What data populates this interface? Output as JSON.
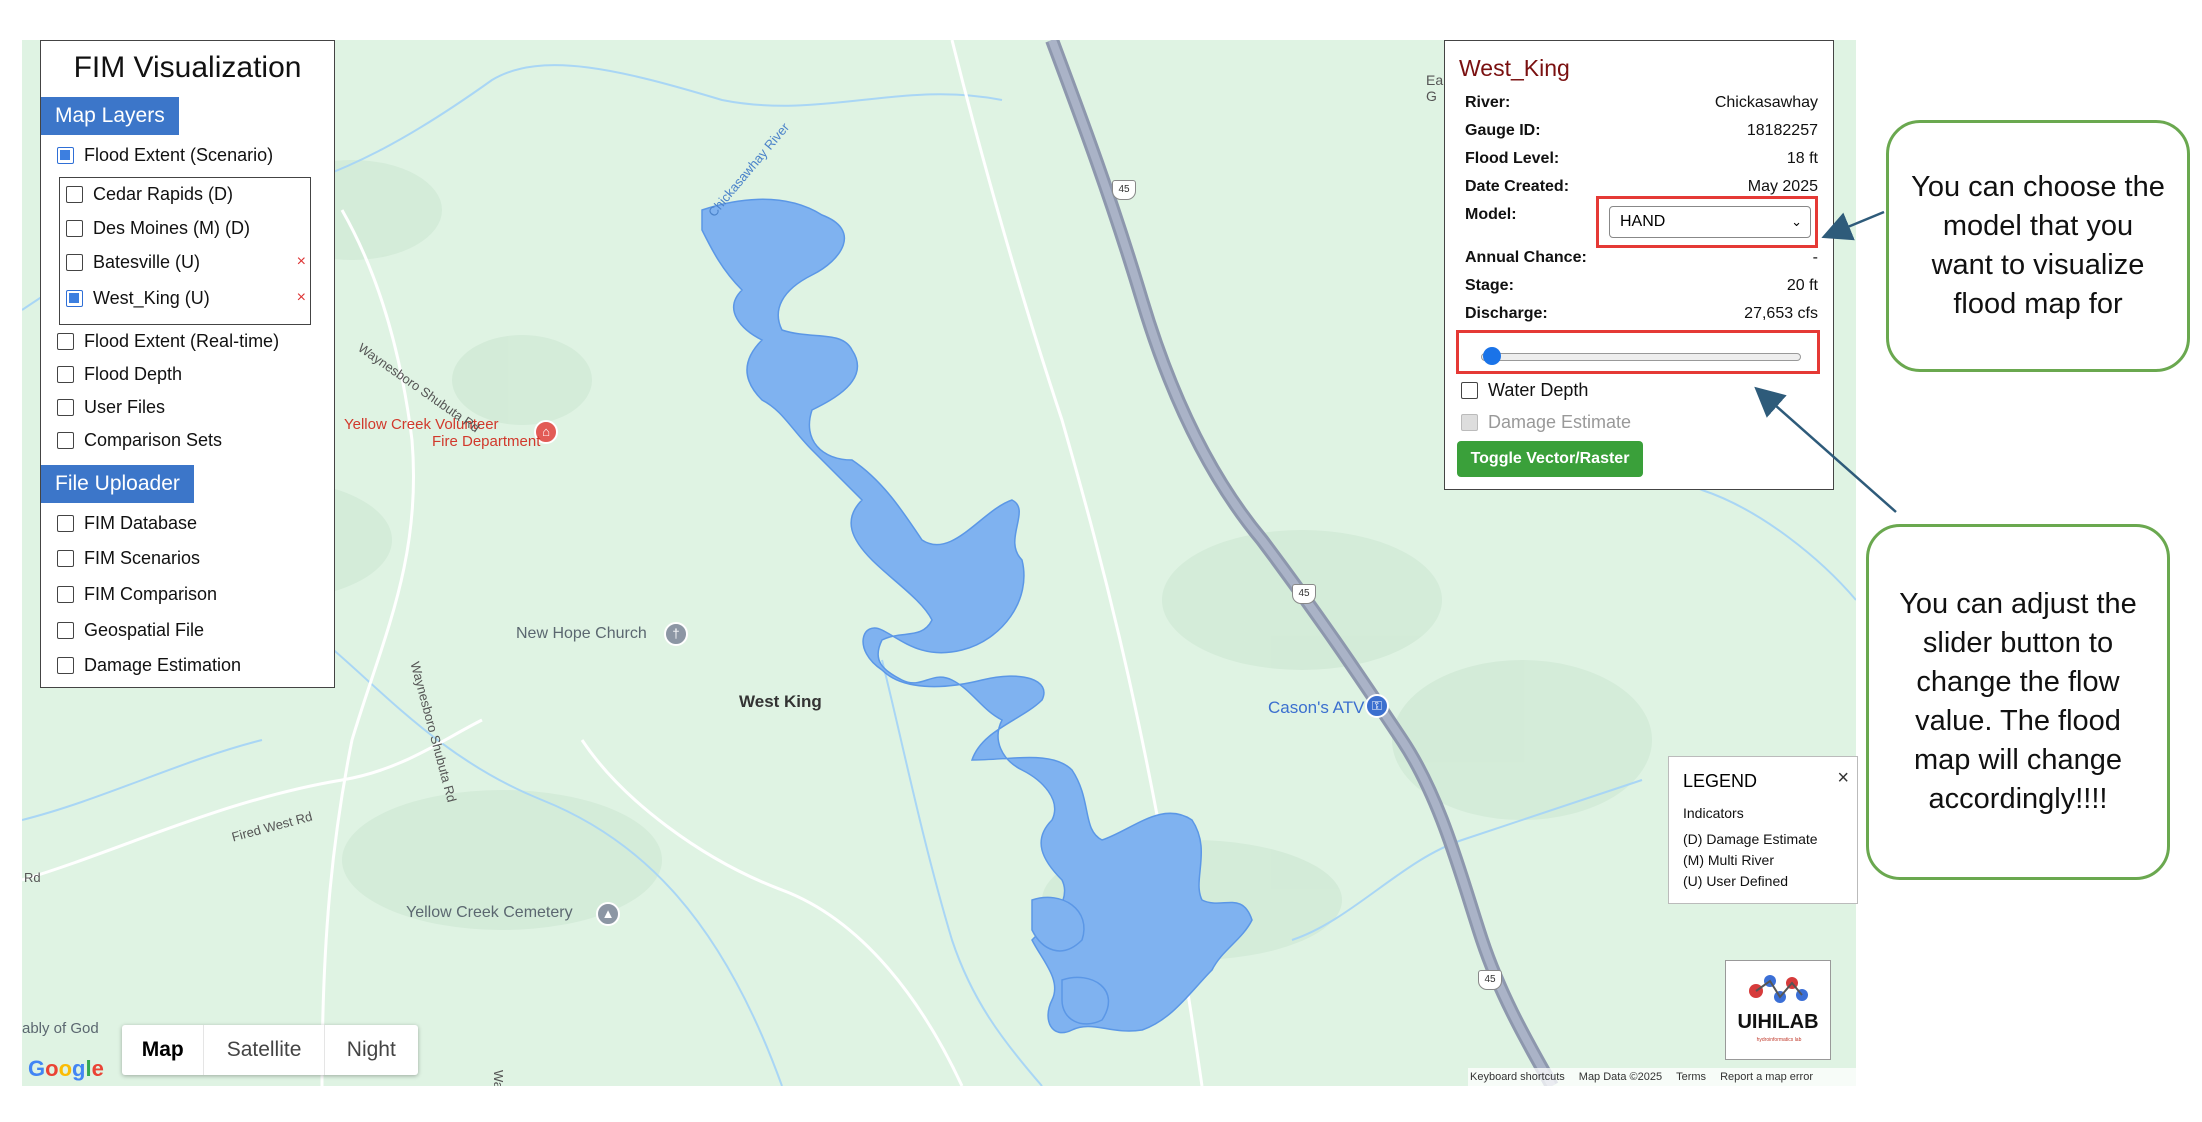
{
  "left_panel": {
    "title": "FIM Visualization",
    "map_layers_heading": "Map Layers",
    "flood_extent_scenario": "Flood Extent (Scenario)",
    "scenarios": [
      {
        "label": "Cedar Rapids (D)",
        "checked": false,
        "removable": false
      },
      {
        "label": "Des Moines (M) (D)",
        "checked": false,
        "removable": false
      },
      {
        "label": "Batesville (U)",
        "checked": false,
        "removable": true
      },
      {
        "label": "West_King (U)",
        "checked": true,
        "removable": true
      }
    ],
    "layers": [
      "Flood Extent (Real-time)",
      "Flood Depth",
      "User Files",
      "Comparison Sets"
    ],
    "file_uploader_heading": "File Uploader",
    "uploader_items": [
      "FIM Database",
      "FIM Scenarios",
      "FIM Comparison",
      "Geospatial File",
      "Damage Estimation"
    ],
    "remove_glyph": "×"
  },
  "info_panel": {
    "title": "West_King",
    "river_label": "River:",
    "river": "Chickasawhay",
    "gauge_label": "Gauge ID:",
    "gauge": "18182257",
    "flood_level_label": "Flood Level:",
    "flood_level": "18 ft",
    "date_label": "Date Created:",
    "date": "May 2025",
    "model_label": "Model:",
    "model": "HAND",
    "annual_label": "Annual Chance:",
    "annual": "-",
    "stage_label": "Stage:",
    "stage": "20 ft",
    "discharge_label": "Discharge:",
    "discharge": "27,653 cfs",
    "slider_value": 0.0,
    "water_depth": "Water Depth",
    "damage_estimate": "Damage Estimate",
    "toggle_button": "Toggle Vector/Raster"
  },
  "callouts": {
    "model": "You can choose the model that you want to visualize flood map for",
    "slider": "You can adjust the slider button to change the flow value. The flood map will change accordingly!!!!"
  },
  "legend": {
    "title": "LEGEND",
    "close": "×",
    "subtitle": "Indicators",
    "items": [
      "(D) Damage Estimate",
      "(M) Multi River",
      "(U) User Defined"
    ]
  },
  "logo": {
    "name": "UIHILAB",
    "tagline": "hydroinformatics lab"
  },
  "map": {
    "labels": {
      "yellow_creek_vfd_1": "Yellow Creek Volunteer",
      "yellow_creek_vfd_2": "Fire Department",
      "new_hope_church": "New Hope Church",
      "west_king": "West King",
      "casons_atv": "Cason's ATV",
      "yellow_creek_cemetery": "Yellow Creek Cemetery",
      "waynesboro_shubuta_1": "Waynesboro Shubuta Rd",
      "waynesboro_shubuta_2": "Waynesboro Shubuta Rd",
      "fired_west_rd": "Fired West Rd",
      "rd_edge": "Rd",
      "assembly": "ably of God",
      "chickasawhay_river": "Chickasawhay River",
      "wayne_edge": "Wayne",
      "ea_edge": "Ea",
      "g_edge": "G",
      "hwy_45": "45"
    },
    "map_types": [
      "Map",
      "Satellite",
      "Night"
    ],
    "active_map_type": "Map",
    "google": "Google",
    "attribution": [
      "Keyboard shortcuts",
      "Map Data ©2025",
      "Terms",
      "Report a map error"
    ],
    "flood_color": "#7fb2f0",
    "land_color": "#dff3e3"
  }
}
